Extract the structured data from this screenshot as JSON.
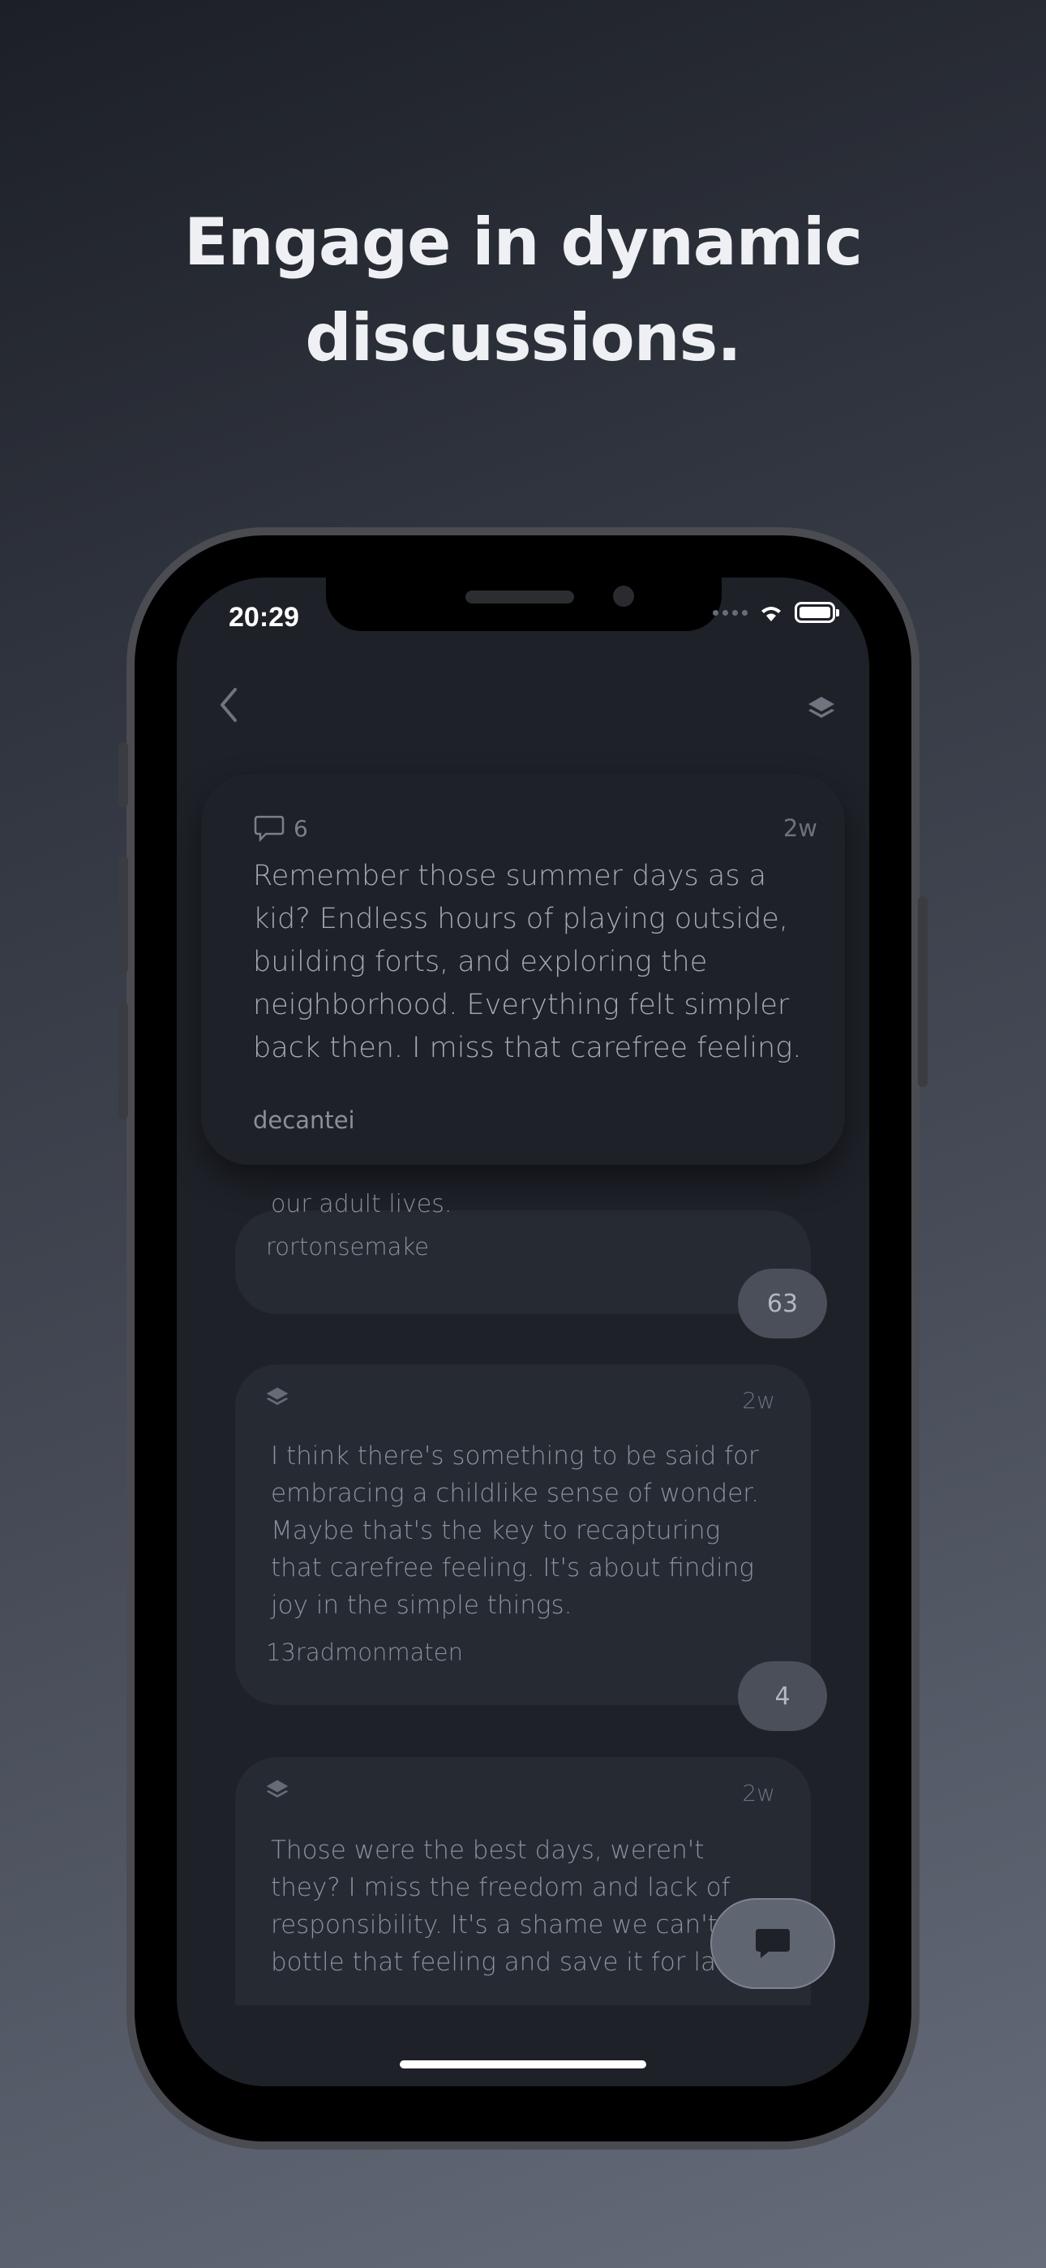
{
  "headline": {
    "line1": "Engage in dynamic",
    "line2": "discussions."
  },
  "status_bar": {
    "time": "20:29"
  },
  "icons": {
    "back": "chevron-left-icon",
    "layers": "layers-icon",
    "comment": "comment-icon",
    "chat": "chat-bubble-icon",
    "wifi": "wifi-icon",
    "battery": "battery-icon"
  },
  "main_post": {
    "comment_count": "6",
    "time": "2w",
    "text": "Remember those summer days as a kid? Endless hours of playing outside, building forts, and exploring the neighborhood. Everything felt simpler back then. I miss that carefree feeling.",
    "author": "decantei"
  },
  "replies": [
    {
      "text_tail": "our adult lives.",
      "author": "rortonsemake",
      "count": "63"
    },
    {
      "time": "2w",
      "text": "I think there's something to be said for embracing a childlike sense of wonder. Maybe that's the key to recapturing that carefree feeling. It's about finding joy in the simple things.",
      "author": "13radmonmaten",
      "count": "4"
    },
    {
      "time": "2w",
      "text": "Those were the best days, weren't they? I miss the freedom and lack of responsibility. It's a shame we can't bottle that feeling and save it for later."
    }
  ],
  "colors": {
    "accent": "#5f6571",
    "card": "#252a33",
    "screen": "#1e2128"
  }
}
